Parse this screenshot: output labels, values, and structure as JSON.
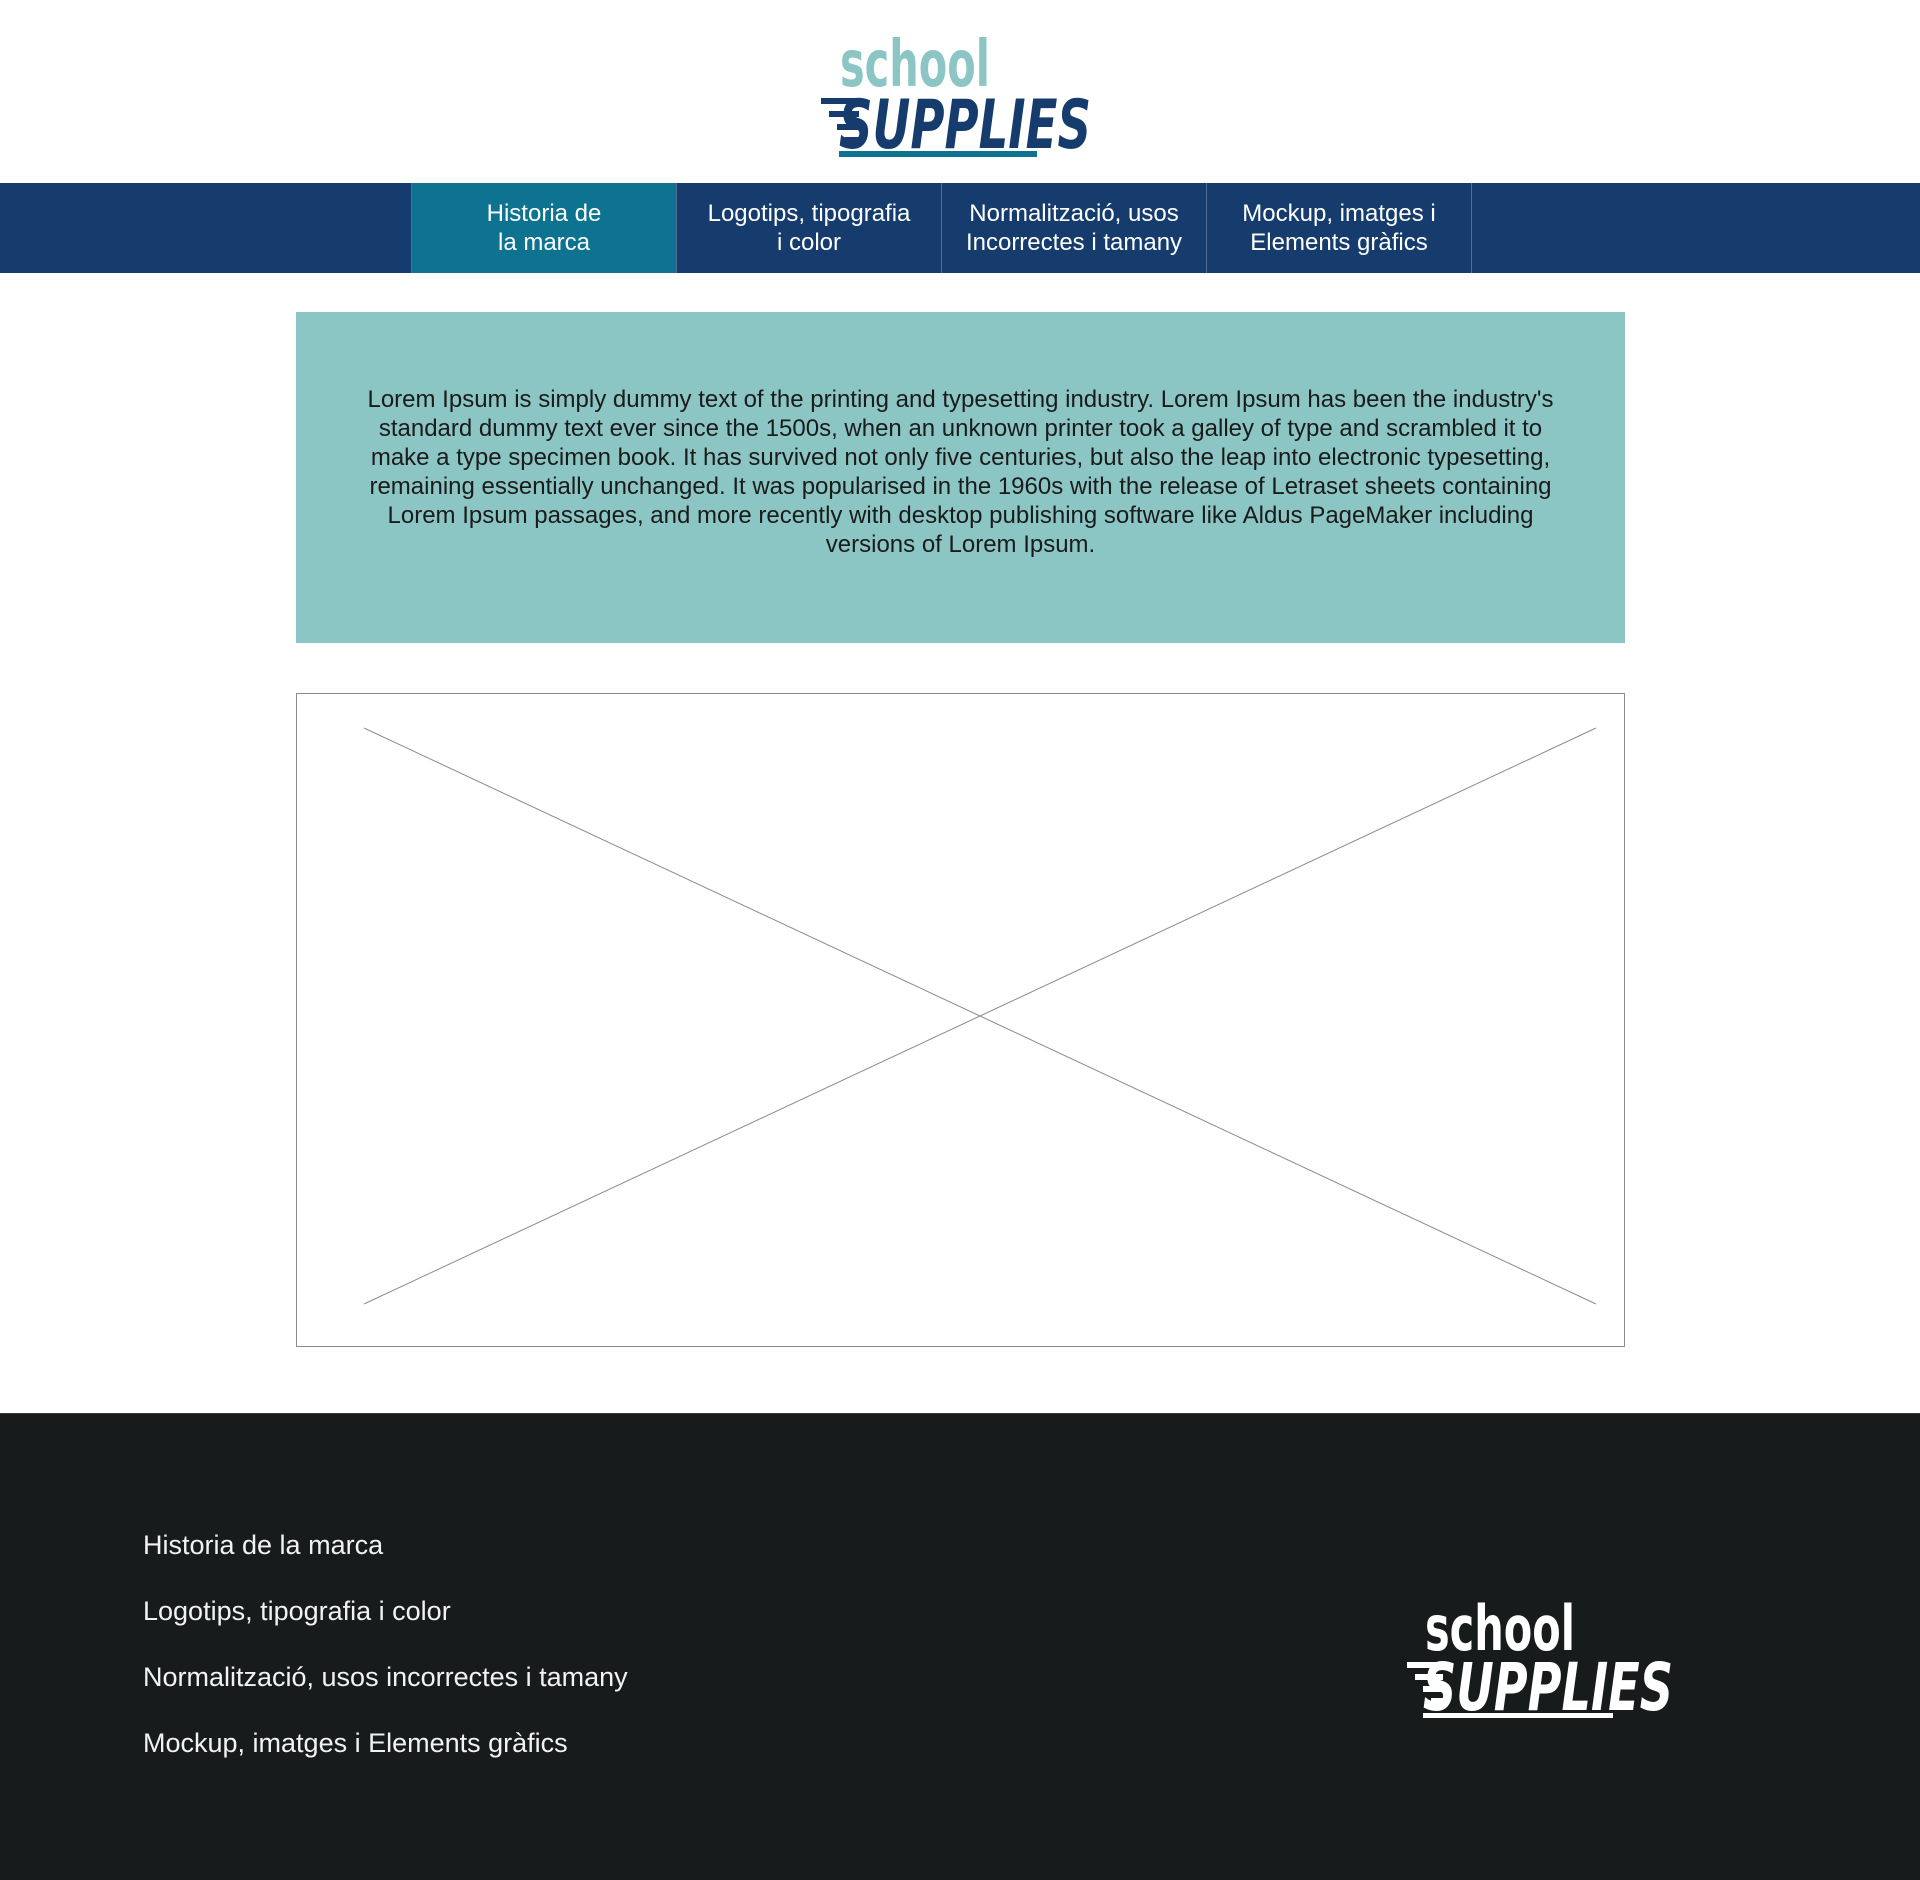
{
  "colors": {
    "nav_background": "#163c6d",
    "nav_active": "#0d7390",
    "intro_background": "#8bc6c4",
    "footer_background": "#181b1c",
    "logo_light": "#8bc6c4",
    "logo_dark": "#163c6d",
    "logo_accent": "#0d7390"
  },
  "logo": {
    "line1": "school",
    "line2": "SUPPLIES"
  },
  "nav": {
    "tabs": [
      {
        "label": "Historia de\nla marca",
        "active": true
      },
      {
        "label": "Logotips, tipografia\ni color",
        "active": false
      },
      {
        "label": "Normalització, usos\nIncorrectes i tamany",
        "active": false
      },
      {
        "label": "Mockup, imatges i\nElements gràfics",
        "active": false
      }
    ]
  },
  "intro": {
    "text": "Lorem Ipsum is simply dummy text of the printing and typesetting industry. Lorem Ipsum has been the industry's standard dummy text ever since the 1500s, when an unknown printer took a galley of type and scrambled it to make a type specimen book. It has survived not only five centuries, but also the leap into electronic typesetting, remaining essentially unchanged. It was popularised in the 1960s with the release of Letraset sheets containing Lorem Ipsum passages, and more recently with desktop publishing software like Aldus PageMaker including versions of Lorem Ipsum."
  },
  "footer": {
    "links": [
      "Historia de la marca",
      "Logotips, tipografia i color",
      "Normalització, usos incorrectes i tamany",
      "Mockup, imatges i Elements gràfics"
    ],
    "logo": {
      "line1": "school",
      "line2": "SUPPLIES"
    }
  }
}
